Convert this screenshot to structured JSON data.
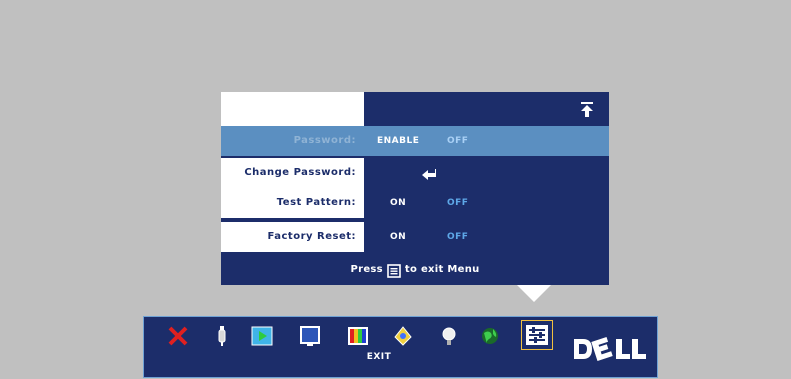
{
  "menu": {
    "rows": [
      {
        "label": "Password:",
        "option_on": "ENABLE",
        "option_off": "OFF"
      },
      {
        "label": "Change Password:"
      },
      {
        "label": "Test Pattern:",
        "option_on": "ON",
        "option_off": "OFF"
      },
      {
        "label": "Factory Reset:",
        "option_on": "ON",
        "option_off": "OFF"
      }
    ],
    "footer_prefix": "Press",
    "footer_suffix": "to exit Menu"
  },
  "taskbar": {
    "icons": [
      "exit-x-icon",
      "input-select-icon",
      "auto-adjust-icon",
      "picture-settings-icon",
      "display-settings-icon",
      "lamp-icon",
      "languages-icon",
      "management-icon",
      "others-icon"
    ],
    "selected_label": "EXIT",
    "logo_text": "DELL"
  },
  "colors": {
    "panel_blue": "#1c2d6a",
    "highlight_blue": "#5b8fc1",
    "background_gray": "#c0c0c0",
    "option_on_color": "#ffffff",
    "option_off_color": "#5ea8e8"
  }
}
